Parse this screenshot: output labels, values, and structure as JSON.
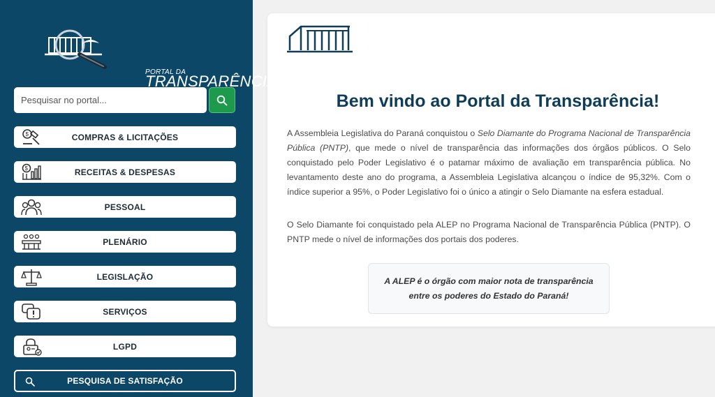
{
  "logo": {
    "line1": "PORTAL DA",
    "line2": "TRANSPARÊNCIA"
  },
  "search": {
    "placeholder": "Pesquisar no portal...",
    "icon": "search-icon"
  },
  "menu": [
    {
      "label": "COMPRAS & LICITAÇÕES",
      "icon": "gavel-icon"
    },
    {
      "label": "RECEITAS & DESPESAS",
      "icon": "finance-chart-icon"
    },
    {
      "label": "PESSOAL",
      "icon": "people-group-icon"
    },
    {
      "label": "PLENÁRIO",
      "icon": "plenary-icon"
    },
    {
      "label": "LEGISLAÇÃO",
      "icon": "scales-icon"
    },
    {
      "label": "SERVIÇOS",
      "icon": "chat-alert-icon"
    },
    {
      "label": "LGPD",
      "icon": "lock-user-icon"
    }
  ],
  "survey": {
    "label": "PESQUISA DE SATISFAÇÃO",
    "icon": "search-icon"
  },
  "main": {
    "title": "Bem vindo ao Portal da Transparência!",
    "para1_a": "A Assembleia Legislativa do Paraná conquistou o ",
    "para1_em": "Selo Diamante do Programa Nacional de Transparência Pública (PNTP)",
    "para1_b": ", que mede o nível de transparência das informações dos órgãos públicos. O Selo conquistado pelo Poder Legislativo é o patamar máximo de avaliação em transparência pública. No levantamento deste ano do programa, a Assembleia Legislativa alcançou o índice de 95,32%. Com o índice superior a 95%, o Poder Legislativo foi o único a atingir o Selo Diamante na esfera estadual.",
    "para2": "O Selo Diamante foi conquistado pela ALEP no Programa Nacional de Transparência Pública (PNTP). O PNTP mede o nível de informações dos portais dos poderes.",
    "quote": "A ALEP é o órgão com maior nota de transparência entre os poderes do Estado do Paraná!"
  },
  "colors": {
    "sidebar": "#0d4767",
    "search_button": "#1e9a4d",
    "title": "#0f3d57"
  }
}
